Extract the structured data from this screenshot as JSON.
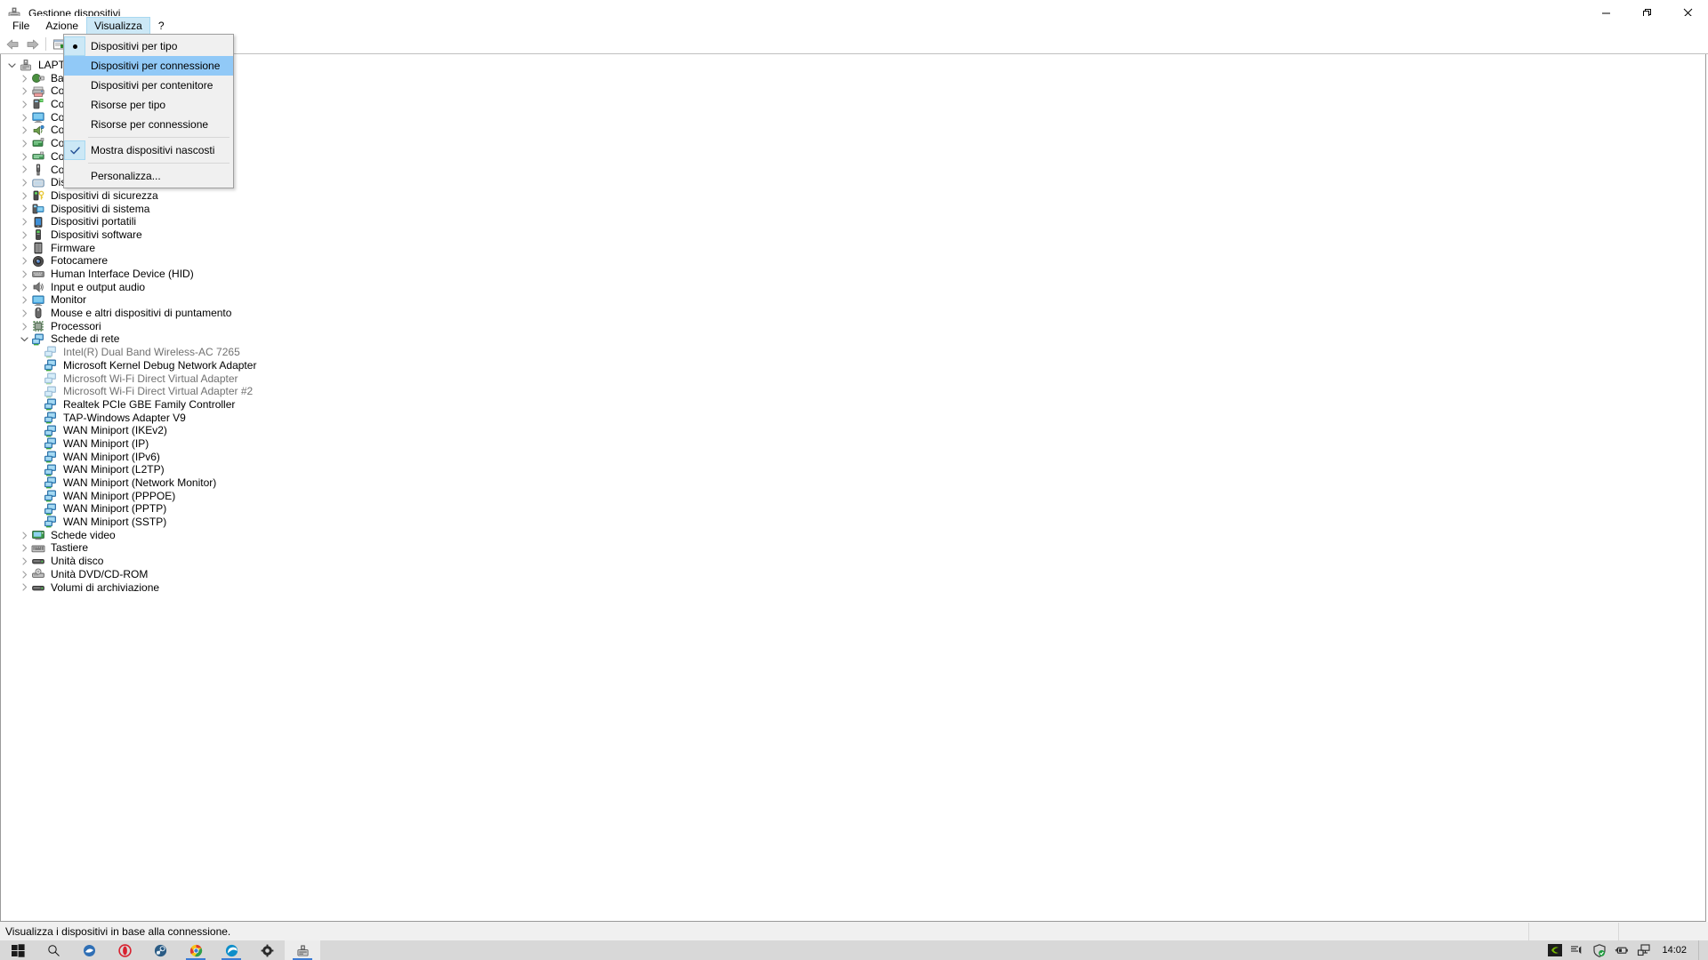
{
  "window": {
    "title": "Gestione dispositivi",
    "app_icon": "device-manager-icon",
    "minimize_label": "—",
    "maximize_label": "❐",
    "close_label": "✕"
  },
  "menubar": {
    "items": [
      {
        "label": "File",
        "open": false
      },
      {
        "label": "Azione",
        "open": false
      },
      {
        "label": "Visualizza",
        "open": true
      },
      {
        "label": "?",
        "open": false
      }
    ]
  },
  "toolbar": {
    "back_label": "back-arrow",
    "forward_label": "forward-arrow",
    "properties_label": "properties"
  },
  "dropdown": {
    "items": [
      {
        "label": "Dispositivi per tipo",
        "marker": "radio",
        "highlight": false,
        "separator_after": false
      },
      {
        "label": "Dispositivi per connessione",
        "marker": "none",
        "highlight": true,
        "separator_after": false
      },
      {
        "label": "Dispositivi per contenitore",
        "marker": "none",
        "highlight": false,
        "separator_after": false
      },
      {
        "label": "Risorse per tipo",
        "marker": "none",
        "highlight": false,
        "separator_after": false
      },
      {
        "label": "Risorse per connessione",
        "marker": "none",
        "highlight": false,
        "separator_after": true
      },
      {
        "label": "Mostra dispositivi nascosti",
        "marker": "check",
        "highlight": false,
        "separator_after": true
      },
      {
        "label": "Personalizza...",
        "marker": "none",
        "highlight": false,
        "separator_after": false
      }
    ]
  },
  "tree": {
    "rows": [
      {
        "label": "LAPTOP",
        "depth": 0,
        "expander": "down",
        "icon": "computer-icon",
        "dim": false
      },
      {
        "label": "Batterie",
        "depth": 1,
        "expander": "right",
        "icon": "battery-icon",
        "dim": false
      },
      {
        "label": "Code di stampa",
        "depth": 1,
        "expander": "right",
        "icon": "printer-icon",
        "dim": false
      },
      {
        "label": "Computer",
        "depth": 1,
        "expander": "right",
        "icon": "computer-small-icon",
        "dim": false
      },
      {
        "label": "Computer",
        "depth": 1,
        "expander": "right",
        "icon": "monitor-icon",
        "dim": false
      },
      {
        "label": "Controller audio, video e giochi",
        "depth": 1,
        "expander": "right",
        "icon": "audio-icon",
        "dim": false
      },
      {
        "label": "Controller host IEEE 1394",
        "depth": 1,
        "expander": "right",
        "icon": "controller-icon",
        "dim": false
      },
      {
        "label": "Controller IDE ATA/ATAPI",
        "depth": 1,
        "expander": "right",
        "icon": "ide-icon",
        "dim": false
      },
      {
        "label": "Controller USB (Universal Serial Bus)",
        "depth": 1,
        "expander": "right",
        "icon": "usb-icon",
        "dim": false
      },
      {
        "label": "Dispositivi delle tecnologie di memoria",
        "depth": 1,
        "expander": "right",
        "icon": "memory-icon",
        "dim": false
      },
      {
        "label": "Dispositivi di sicurezza",
        "depth": 1,
        "expander": "right",
        "icon": "security-icon",
        "dim": false
      },
      {
        "label": "Dispositivi di sistema",
        "depth": 1,
        "expander": "right",
        "icon": "system-icon",
        "dim": false
      },
      {
        "label": "Dispositivi portatili",
        "depth": 1,
        "expander": "right",
        "icon": "portable-icon",
        "dim": false
      },
      {
        "label": "Dispositivi software",
        "depth": 1,
        "expander": "right",
        "icon": "software-icon",
        "dim": false
      },
      {
        "label": "Firmware",
        "depth": 1,
        "expander": "right",
        "icon": "firmware-icon",
        "dim": false
      },
      {
        "label": "Fotocamere",
        "depth": 1,
        "expander": "right",
        "icon": "camera-icon",
        "dim": false
      },
      {
        "label": "Human Interface Device (HID)",
        "depth": 1,
        "expander": "right",
        "icon": "hid-icon",
        "dim": false
      },
      {
        "label": "Input e output audio",
        "depth": 1,
        "expander": "right",
        "icon": "speaker-icon",
        "dim": false
      },
      {
        "label": "Monitor",
        "depth": 1,
        "expander": "right",
        "icon": "monitor-icon",
        "dim": false
      },
      {
        "label": "Mouse e altri dispositivi di puntamento",
        "depth": 1,
        "expander": "right",
        "icon": "mouse-icon",
        "dim": false
      },
      {
        "label": "Processori",
        "depth": 1,
        "expander": "right",
        "icon": "cpu-icon",
        "dim": false
      },
      {
        "label": "Schede di rete",
        "depth": 1,
        "expander": "down",
        "icon": "network-icon",
        "dim": false
      },
      {
        "label": "Intel(R) Dual Band Wireless-AC 7265",
        "depth": 2,
        "expander": "none",
        "icon": "network-adapter-icon",
        "dim": true
      },
      {
        "label": "Microsoft Kernel Debug Network Adapter",
        "depth": 2,
        "expander": "none",
        "icon": "network-adapter-icon",
        "dim": false
      },
      {
        "label": "Microsoft Wi-Fi Direct Virtual Adapter",
        "depth": 2,
        "expander": "none",
        "icon": "network-adapter-icon",
        "dim": true
      },
      {
        "label": "Microsoft Wi-Fi Direct Virtual Adapter #2",
        "depth": 2,
        "expander": "none",
        "icon": "network-adapter-icon",
        "dim": true
      },
      {
        "label": "Realtek PCIe GBE Family Controller",
        "depth": 2,
        "expander": "none",
        "icon": "network-adapter-icon",
        "dim": false
      },
      {
        "label": "TAP-Windows Adapter V9",
        "depth": 2,
        "expander": "none",
        "icon": "network-adapter-icon",
        "dim": false
      },
      {
        "label": "WAN Miniport (IKEv2)",
        "depth": 2,
        "expander": "none",
        "icon": "network-adapter-icon",
        "dim": false
      },
      {
        "label": "WAN Miniport (IP)",
        "depth": 2,
        "expander": "none",
        "icon": "network-adapter-icon",
        "dim": false
      },
      {
        "label": "WAN Miniport (IPv6)",
        "depth": 2,
        "expander": "none",
        "icon": "network-adapter-icon",
        "dim": false
      },
      {
        "label": "WAN Miniport (L2TP)",
        "depth": 2,
        "expander": "none",
        "icon": "network-adapter-icon",
        "dim": false
      },
      {
        "label": "WAN Miniport (Network Monitor)",
        "depth": 2,
        "expander": "none",
        "icon": "network-adapter-icon",
        "dim": false
      },
      {
        "label": "WAN Miniport (PPPOE)",
        "depth": 2,
        "expander": "none",
        "icon": "network-adapter-icon",
        "dim": false
      },
      {
        "label": "WAN Miniport (PPTP)",
        "depth": 2,
        "expander": "none",
        "icon": "network-adapter-icon",
        "dim": false
      },
      {
        "label": "WAN Miniport (SSTP)",
        "depth": 2,
        "expander": "none",
        "icon": "network-adapter-icon",
        "dim": false
      },
      {
        "label": "Schede video",
        "depth": 1,
        "expander": "right",
        "icon": "display-adapter-icon",
        "dim": false
      },
      {
        "label": "Tastiere",
        "depth": 1,
        "expander": "right",
        "icon": "keyboard-icon",
        "dim": false
      },
      {
        "label": "Unità disco",
        "depth": 1,
        "expander": "right",
        "icon": "disk-icon",
        "dim": false
      },
      {
        "label": "Unità DVD/CD-ROM",
        "depth": 1,
        "expander": "right",
        "icon": "dvd-icon",
        "dim": false
      },
      {
        "label": "Volumi di archiviazione",
        "depth": 1,
        "expander": "right",
        "icon": "volume-icon",
        "dim": false
      }
    ]
  },
  "statusbar": {
    "text": "Visualizza i dispositivi in base alla connessione."
  },
  "taskbar": {
    "items": [
      {
        "name": "start-button",
        "icon": "windows-logo-icon",
        "active": false,
        "running": false
      },
      {
        "name": "search-button",
        "icon": "search-icon",
        "active": false,
        "running": false
      },
      {
        "name": "taskview-button",
        "icon": "app-blue-icon",
        "active": false,
        "running": false
      },
      {
        "name": "opera-button",
        "icon": "opera-icon",
        "active": false,
        "running": false
      },
      {
        "name": "steam-button",
        "icon": "steam-icon",
        "active": false,
        "running": false
      },
      {
        "name": "chrome-button",
        "icon": "chrome-icon",
        "active": false,
        "running": true
      },
      {
        "name": "edge-button",
        "icon": "edge-icon",
        "active": false,
        "running": true
      },
      {
        "name": "settings-button",
        "icon": "gear-icon",
        "active": false,
        "running": false
      },
      {
        "name": "device-manager-button",
        "icon": "device-manager-icon",
        "active": true,
        "running": true
      }
    ],
    "tray": [
      {
        "name": "nvidia-tray-icon",
        "icon": "nvidia-icon"
      },
      {
        "name": "volume-tray-icon",
        "icon": "volume-icon"
      },
      {
        "name": "security-tray-icon",
        "icon": "shield-check-icon"
      },
      {
        "name": "battery-tray-icon",
        "icon": "battery-charging-icon"
      },
      {
        "name": "network-tray-icon",
        "icon": "ethernet-icon"
      }
    ],
    "clock": "14:02"
  },
  "colors": {
    "accent": "#0078d7",
    "menu_highlight": "#91c9f7",
    "menu_open": "#cce8f6",
    "taskbar": "#d8d8d8",
    "statusbar": "#f0f0f0"
  }
}
